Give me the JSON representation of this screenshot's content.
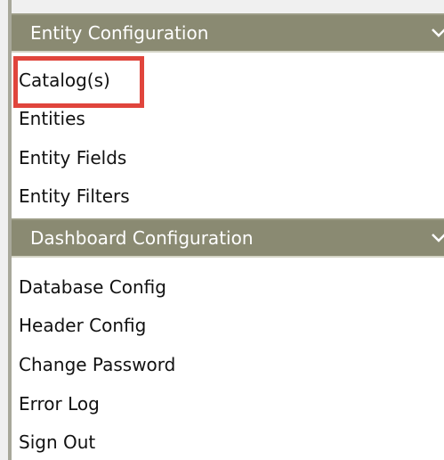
{
  "sections": [
    {
      "title": "Entity Configuration",
      "chevron_icon": "chevron-down-icon",
      "items": [
        {
          "label": "Catalog(s)",
          "highlighted": true
        },
        {
          "label": "Entities"
        },
        {
          "label": "Entity Fields"
        },
        {
          "label": "Entity Filters"
        }
      ]
    },
    {
      "title": "Dashboard Configuration",
      "chevron_icon": "chevron-down-icon",
      "items": [
        {
          "label": "Database Config"
        },
        {
          "label": "Header Config"
        },
        {
          "label": "Change Password"
        },
        {
          "label": "Error Log"
        },
        {
          "label": "Sign Out"
        }
      ]
    }
  ],
  "colors": {
    "header_bg": "#8a8a72",
    "highlight_border": "#e0453c",
    "text": "#111111"
  }
}
